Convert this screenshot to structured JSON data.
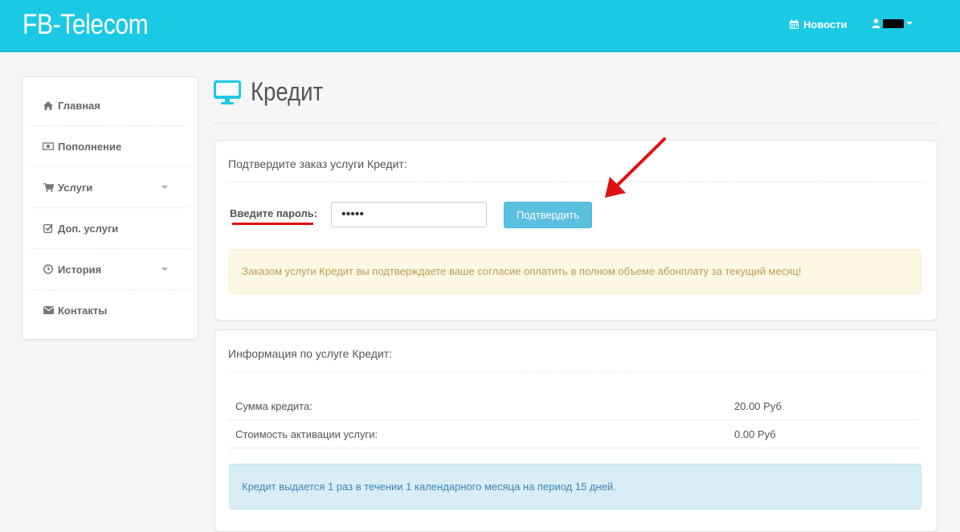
{
  "header": {
    "brand": "FB-Telecom",
    "news_label": "Новости",
    "user_name": ""
  },
  "sidebar": {
    "items": [
      {
        "label": "Главная",
        "icon": "home-icon",
        "has_caret": false
      },
      {
        "label": "Пополнение",
        "icon": "money-icon",
        "has_caret": false
      },
      {
        "label": "Услуги",
        "icon": "cart-icon",
        "has_caret": true
      },
      {
        "label": "Доп. услуги",
        "icon": "check-square-icon",
        "has_caret": false
      },
      {
        "label": "История",
        "icon": "clock-icon",
        "has_caret": true
      },
      {
        "label": "Контакты",
        "icon": "envelope-icon",
        "has_caret": false
      }
    ]
  },
  "page": {
    "title": "Кредит",
    "title_icon": "desktop-icon"
  },
  "confirm_panel": {
    "title": "Подтвердите заказ услуги Кредит:",
    "password_label": "Введите пароль:",
    "password_value": "•••••",
    "button_label": "Подтвердить",
    "warning_text": "Заказом услуги Кредит вы подтверждаете ваше согласие оплатить в полном объеме абонплату за текущий месяц!"
  },
  "info_panel": {
    "title": "Информация по услуге Кредит:",
    "rows": [
      {
        "label": "Сумма кредита:",
        "value": "20.00 Руб"
      },
      {
        "label": "Стоимость активации услуги:",
        "value": "0.00 Руб"
      }
    ],
    "info_text": "Кредит выдается 1 раз в течении 1 календарного месяца на период 15 дней."
  },
  "colors": {
    "header_bg": "#1cc9e4",
    "accent_button": "#5bc0de",
    "annotation_red": "#e01010",
    "warning_bg": "#fcf8e3",
    "info_bg": "#d9edf7"
  }
}
